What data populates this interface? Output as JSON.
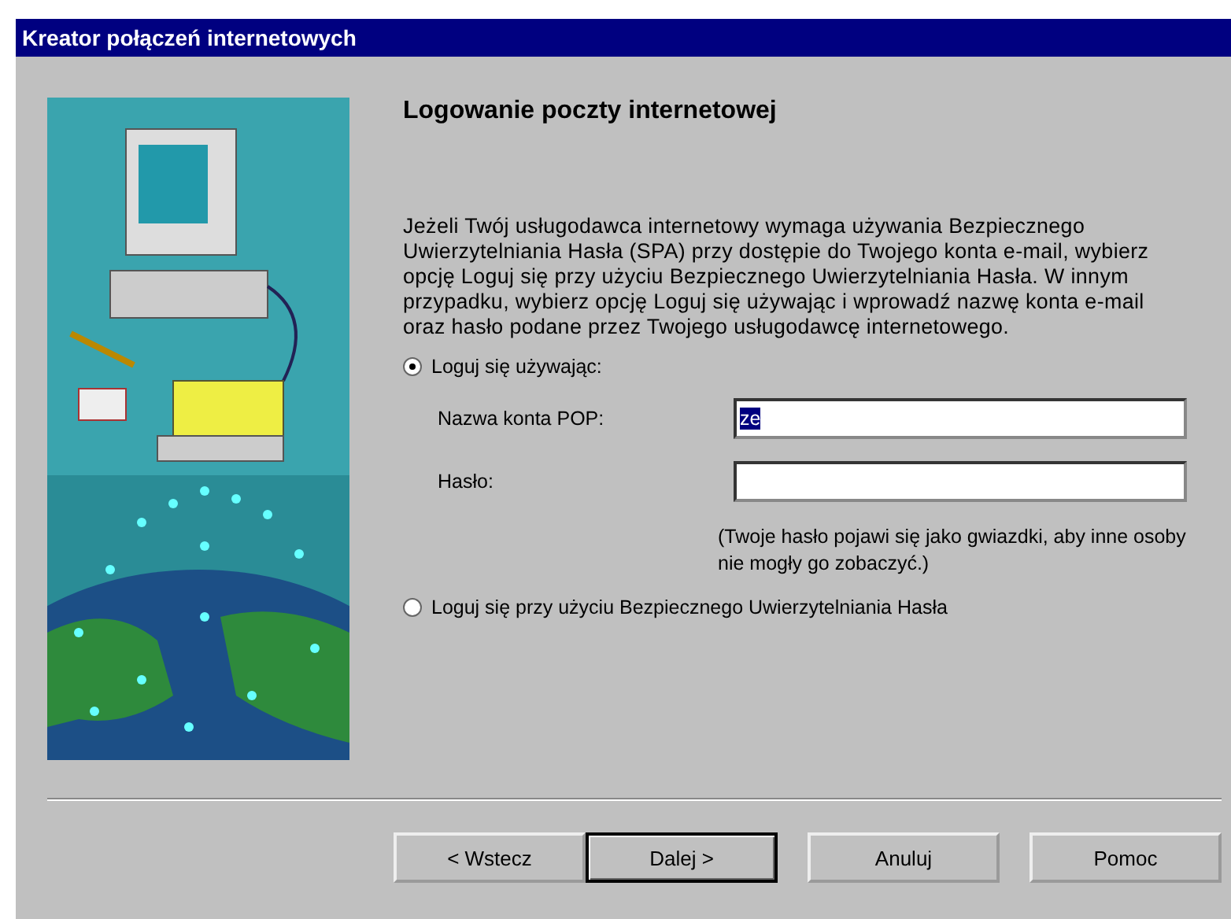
{
  "window": {
    "title": "Kreator połączeń internetowych"
  },
  "heading": "Logowanie poczty internetowej",
  "description": "Jeżeli Twój usługodawca internetowy wymaga używania Bezpiecznego Uwierzytelniania Hasła (SPA) przy dostępie do Twojego konta e-mail, wybierz opcję Loguj się przy użyciu Bezpiecznego Uwierzytelniania Hasła. W innym przypadku, wybierz opcję Loguj się używając i wprowadź nazwę konta e-mail oraz hasło podane przez Twojego usługodawcę internetowego.",
  "options": [
    {
      "label": "Loguj się używając:",
      "selected": true
    },
    {
      "label": "Loguj się przy użyciu Bezpiecznego Uwierzytelniania Hasła",
      "selected": false
    }
  ],
  "fields": [
    {
      "label": "Nazwa konta POP:",
      "value": "ze",
      "value_selected": true
    },
    {
      "label": "Hasło:"
    }
  ],
  "password_note": "(Twoje hasło pojawi się jako gwiazdki, aby inne osoby nie mogły go zobaczyć.)",
  "buttons": [
    {
      "label": "< Wstecz",
      "default": false
    },
    {
      "label": "Dalej >",
      "default": true
    },
    {
      "label": "Anuluj",
      "default": false
    },
    {
      "label": "Pomoc",
      "default": false
    }
  ]
}
